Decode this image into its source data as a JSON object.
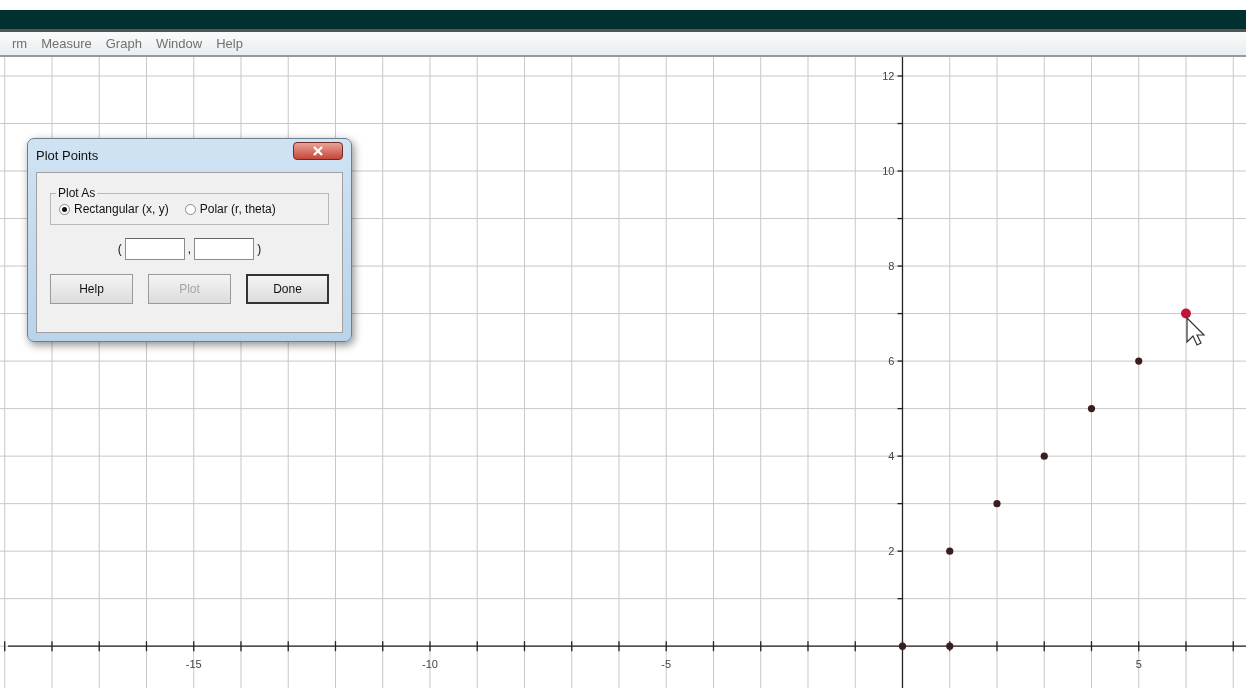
{
  "menu": [
    "rm",
    "Measure",
    "Graph",
    "Window",
    "Help"
  ],
  "dialog": {
    "title": "Plot Points",
    "group_label": "Plot As",
    "options": [
      {
        "label": "Rectangular (x, y)",
        "selected": true
      },
      {
        "label": "Polar (r, theta)",
        "selected": false
      }
    ],
    "open_paren": "(",
    "comma": ",",
    "close_paren": ")",
    "buttons": [
      {
        "label": "Help",
        "disabled": false,
        "default": false
      },
      {
        "label": "Plot",
        "disabled": true,
        "default": false
      },
      {
        "label": "Done",
        "disabled": false,
        "default": true
      }
    ]
  },
  "graph": {
    "chart_data": {
      "type": "scatter",
      "x": [
        0,
        1,
        1,
        2,
        3,
        4,
        5,
        6
      ],
      "series": [
        {
          "color": "#3a1e1e",
          "values": [
            0,
            0,
            2,
            3,
            4,
            5,
            6,
            null
          ]
        },
        {
          "color": "#c0143c",
          "values": [
            null,
            null,
            null,
            null,
            null,
            null,
            null,
            7
          ]
        }
      ],
      "grid": true,
      "xlim": [
        -19.1,
        7.27
      ],
      "ylim": [
        -0.88,
        12.4
      ],
      "xticks": [
        -15,
        -10,
        -5,
        5
      ],
      "yticks": [
        2,
        4,
        6,
        8,
        10,
        12
      ]
    }
  }
}
